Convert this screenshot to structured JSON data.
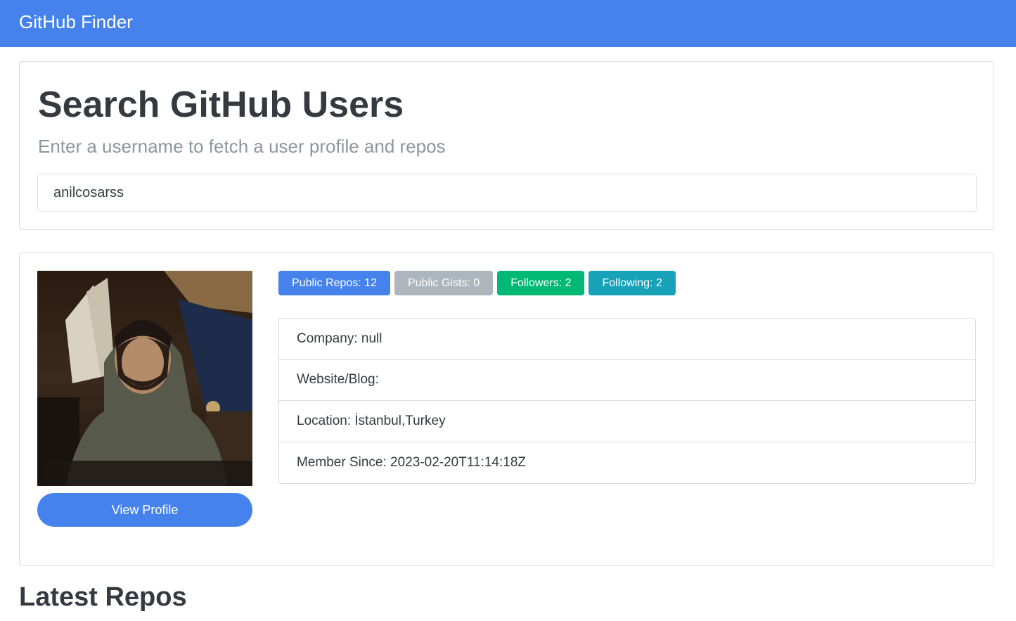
{
  "navbar": {
    "brand": "GitHub Finder"
  },
  "search": {
    "title": "Search GitHub Users",
    "subtitle": "Enter a username to fetch a user profile and repos",
    "value": "anilcosarss",
    "placeholder": ""
  },
  "profile": {
    "view_profile_label": "View Profile",
    "badges": [
      {
        "label": "Public Repos: 12",
        "color": "#4582ec"
      },
      {
        "label": "Public Gists: 0",
        "color": "#adb5bd"
      },
      {
        "label": "Followers: 2",
        "color": "#02b875"
      },
      {
        "label": "Following: 2",
        "color": "#17a2b8"
      }
    ],
    "details": [
      "Company: null",
      "Website/Blog:",
      "Location: İstanbul,Turkey",
      "Member Since: 2023-02-20T11:14:18Z"
    ]
  },
  "repos": {
    "title": "Latest Repos"
  },
  "colors": {
    "accent": "#4582ec",
    "text": "#343a40",
    "muted": "#8e959c"
  }
}
